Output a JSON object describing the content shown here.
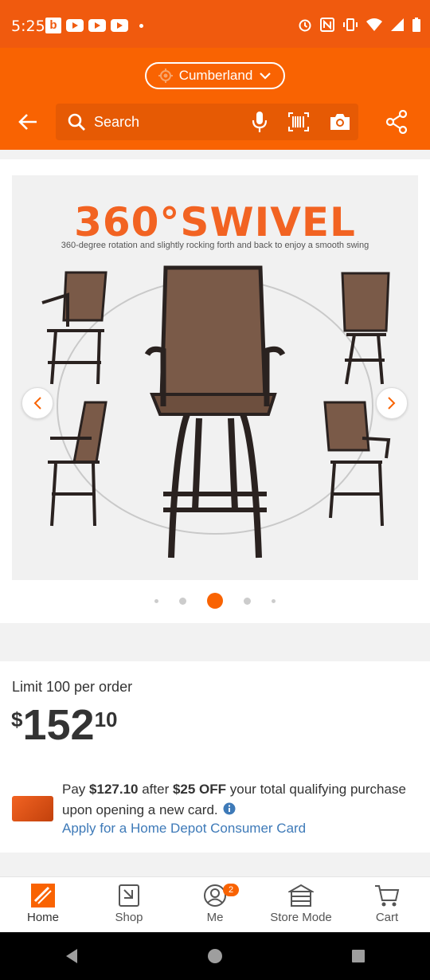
{
  "status_bar": {
    "time": "5:25",
    "app_b": "b"
  },
  "header": {
    "store_name": "Cumberland",
    "search_placeholder": "Search"
  },
  "gallery": {
    "image_title": "360°SWIVEL",
    "image_subtitle": "360-degree rotation and slightly rocking forth and back to enjoy a smooth swing",
    "active_dot": 3,
    "dot_count": 5
  },
  "product": {
    "limit_text": "Limit 100 per order",
    "price_symbol": "$",
    "price_dollars": "152",
    "price_cents": "10",
    "promo_pay": "Pay ",
    "promo_amount": "$127.10",
    "promo_after": " after ",
    "promo_discount": "$25 OFF",
    "promo_rest": " your total qualifying purchase upon opening a new card.",
    "apply_link": "Apply for a Home Depot Consumer Card"
  },
  "bottom_nav": {
    "items": [
      {
        "label": "Home",
        "icon": "home-depot-logo"
      },
      {
        "label": "Shop",
        "icon": "shop-icon"
      },
      {
        "label": "Me",
        "icon": "person-icon"
      },
      {
        "label": "Store Mode",
        "icon": "store-icon"
      },
      {
        "label": "Cart",
        "icon": "cart-icon"
      }
    ],
    "me_badge": "2"
  },
  "colors": {
    "brand": "#f96302",
    "link": "#3e7ab8"
  }
}
